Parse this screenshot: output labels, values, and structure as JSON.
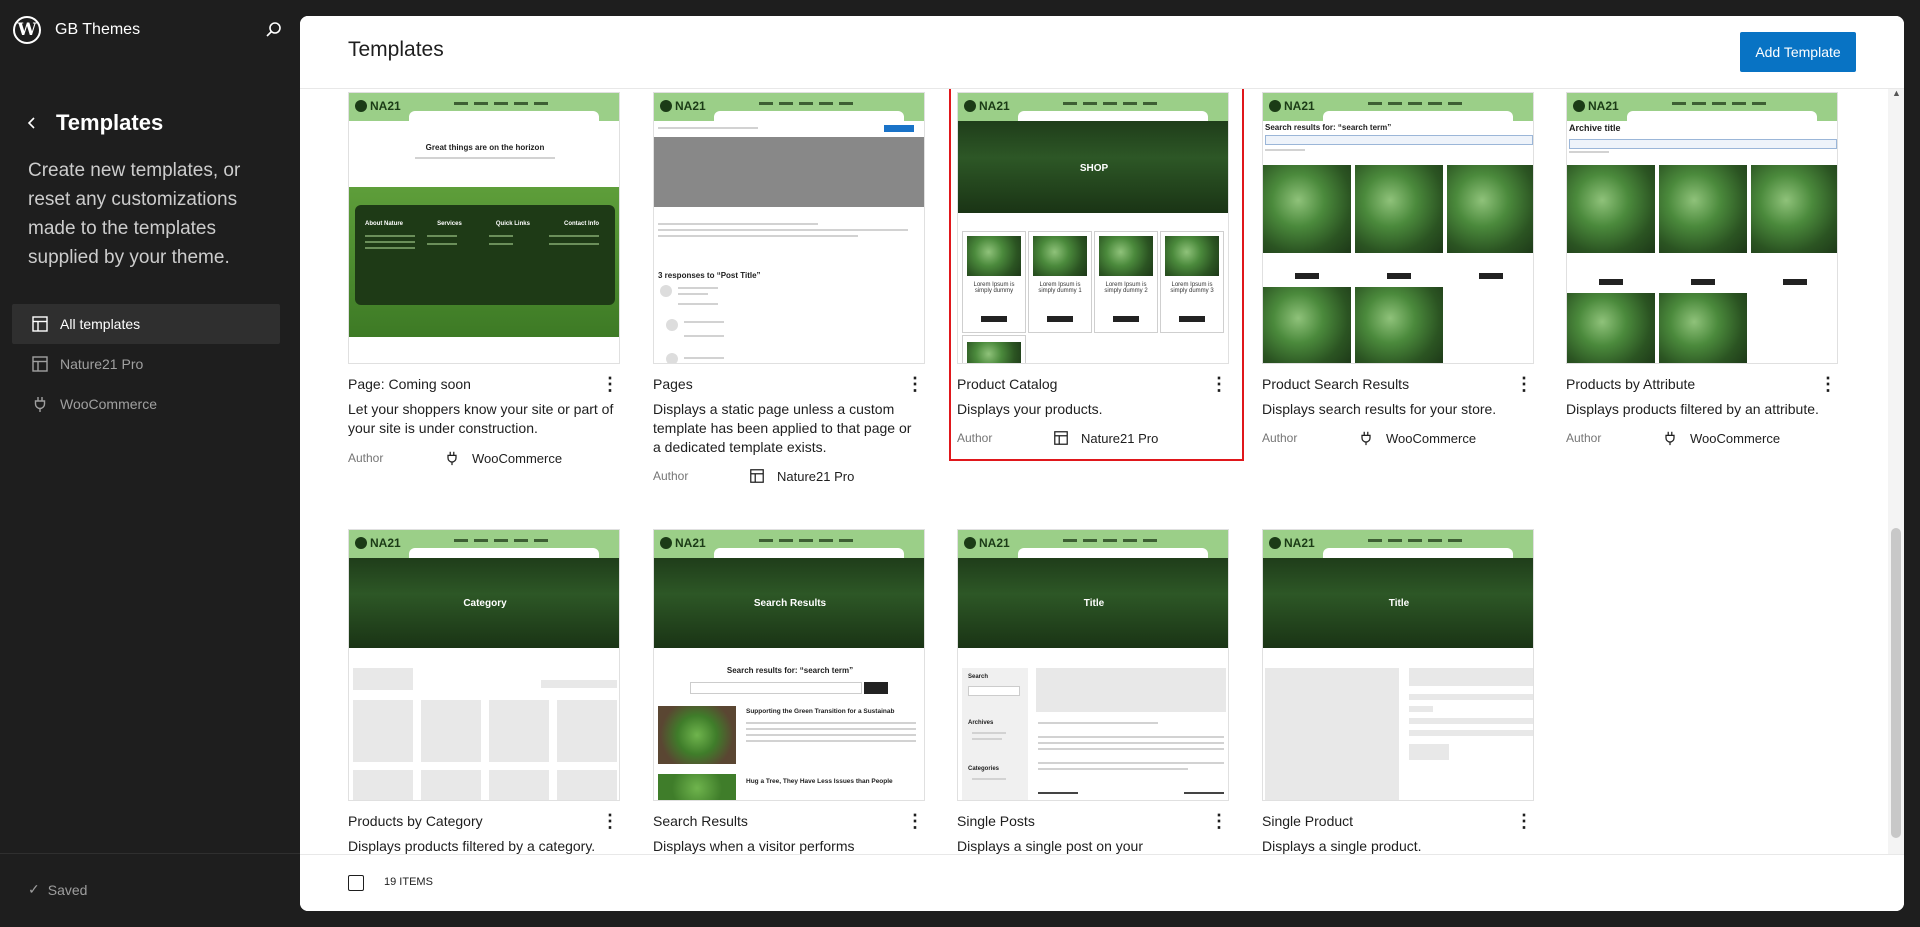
{
  "site": {
    "title": "GB Themes"
  },
  "sidebar": {
    "back_title": "Templates",
    "description": "Create new templates, or reset any customizations made to the templates supplied by your theme.",
    "nav": [
      {
        "label": "All templates",
        "icon": "layout-icon",
        "active": true
      },
      {
        "label": "Nature21 Pro",
        "icon": "layout-icon",
        "active": false
      },
      {
        "label": "WooCommerce",
        "icon": "plugin-icon",
        "active": false
      }
    ],
    "status": "Saved"
  },
  "header": {
    "title": "Templates",
    "add_button": "Add Template"
  },
  "footer": {
    "count": "19 ITEMS"
  },
  "author_label": "Author",
  "cards": [
    {
      "title": "Page: Coming soon",
      "desc": "Let your shoppers know your site or part of your site is under construction.",
      "author": "WooCommerce",
      "author_icon": "plugin-icon",
      "thumb": {
        "heading": "Great things are on the horizon",
        "footer_cols": [
          "About Nature",
          "Services",
          "Quick Links",
          "Contact Info"
        ]
      }
    },
    {
      "title": "Pages",
      "desc": "Displays a static page unless a custom template has been applied to that page or a dedicated template exists.",
      "author": "Nature21 Pro",
      "author_icon": "layout-icon",
      "thumb": {
        "comments": "3 responses to “Post Title”"
      }
    },
    {
      "title": "Product Catalog",
      "desc": "Displays your products.",
      "author": "Nature21 Pro",
      "author_icon": "layout-icon",
      "thumb": {
        "banner": "SHOP",
        "products": [
          "Lorem Ipsum is simply dummy",
          "Lorem Ipsum is simply dummy 1",
          "Lorem Ipsum is simply dummy 2",
          "Lorem Ipsum is simply dummy 3"
        ]
      }
    },
    {
      "title": "Product Search Results",
      "desc": "Displays search results for your store.",
      "author": "WooCommerce",
      "author_icon": "plugin-icon",
      "thumb": {
        "heading": "Search results for: “search term”"
      }
    },
    {
      "title": "Products by Attribute",
      "desc": "Displays products filtered by an attribute.",
      "author": "WooCommerce",
      "author_icon": "plugin-icon",
      "thumb": {
        "heading": "Archive title"
      }
    },
    {
      "title": "Products by Category",
      "desc": "Displays products filtered by a category.",
      "thumb": {
        "banner": "Category"
      }
    },
    {
      "title": "Search Results",
      "desc": "Displays when a visitor performs",
      "thumb": {
        "banner": "Search Results",
        "heading": "Search results for: “search term”",
        "posts": [
          "Supporting the Green Transition for a Sustainab",
          "Hug a Tree, They Have Less Issues than People"
        ]
      }
    },
    {
      "title": "Single Posts",
      "desc": "Displays a single post on your",
      "thumb": {
        "banner": "Title",
        "sidebar_labels": [
          "Search",
          "Archives",
          "Categories"
        ]
      }
    },
    {
      "title": "Single Product",
      "desc": "Displays a single product.",
      "thumb": {
        "banner": "Title"
      }
    }
  ]
}
